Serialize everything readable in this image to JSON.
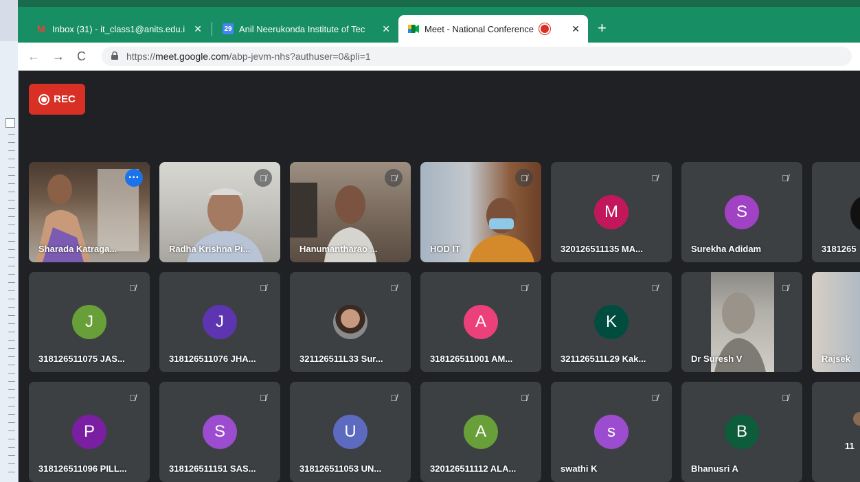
{
  "browser": {
    "tabs": [
      {
        "title": "Inbox (31) - it_class1@anits.edu.i",
        "icon": "gmail-icon"
      },
      {
        "title": "Anil Neerukonda Institute of Tec",
        "icon": "calendar-icon"
      },
      {
        "title": "Meet - National Conference",
        "icon": "meet-icon",
        "active": true,
        "recording": true
      }
    ],
    "url_prefix": "https://",
    "url_host": "meet.google.com",
    "url_path": "/abp-jevm-nhs?authuser=0&pli=1"
  },
  "meet": {
    "rec_label": "REC",
    "accent": "#1a73e8",
    "rec_color": "#d93025",
    "participants": [
      {
        "name": "Sharada Katraga...",
        "video": true,
        "pinned": true
      },
      {
        "name": "Radha Krishna Pi...",
        "video": true
      },
      {
        "name": "Hanumantharao ...",
        "video": true
      },
      {
        "name": "HOD IT",
        "video": true
      },
      {
        "name": "320126511135 MA...",
        "initial": "M",
        "color": "#c2185b"
      },
      {
        "name": "Surekha Adidam",
        "initial": "S",
        "color": "#a142c4"
      },
      {
        "name": "3181265",
        "video": true
      },
      {
        "name": "318126511075 JAS...",
        "initial": "J",
        "color": "#689f38"
      },
      {
        "name": "318126511076 JHA...",
        "initial": "J",
        "color": "#5e35b1"
      },
      {
        "name": "321126511L33 Sur...",
        "photo": true
      },
      {
        "name": "318126511001 AM...",
        "initial": "A",
        "color": "#ec407a"
      },
      {
        "name": "321126511L29 Kak...",
        "initial": "K",
        "color": "#004d40"
      },
      {
        "name": "Dr Suresh V",
        "video": true
      },
      {
        "name": "Rajsek",
        "video": true
      },
      {
        "name": "318126511096 PILL...",
        "initial": "P",
        "color": "#7b1fa2"
      },
      {
        "name": "318126511151 SAS...",
        "initial": "S",
        "color": "#9c4ccf"
      },
      {
        "name": "318126511053 UN...",
        "initial": "U",
        "color": "#5c6bc0"
      },
      {
        "name": "320126511112 ALA...",
        "initial": "A",
        "color": "#689f38"
      },
      {
        "name": "swathi K",
        "initial": "s",
        "color": "#9c4ccf"
      },
      {
        "name": "Bhanusri A",
        "initial": "B",
        "color": "#0d5c3c"
      },
      {
        "name": "11",
        "photo": true
      }
    ]
  }
}
